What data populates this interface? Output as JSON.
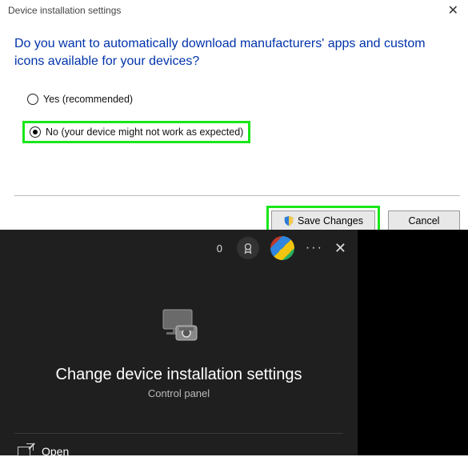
{
  "dialog": {
    "title": "Device installation settings",
    "question": "Do you want to automatically download manufacturers' apps and custom icons available for your devices?",
    "options": {
      "yes": "Yes (recommended)",
      "no": "No (your device might not work as expected)"
    },
    "buttons": {
      "save": "Save Changes",
      "cancel": "Cancel"
    }
  },
  "search": {
    "points": "0",
    "result_title": "Change device installation settings",
    "result_sub": "Control panel",
    "open_label": "Open"
  }
}
